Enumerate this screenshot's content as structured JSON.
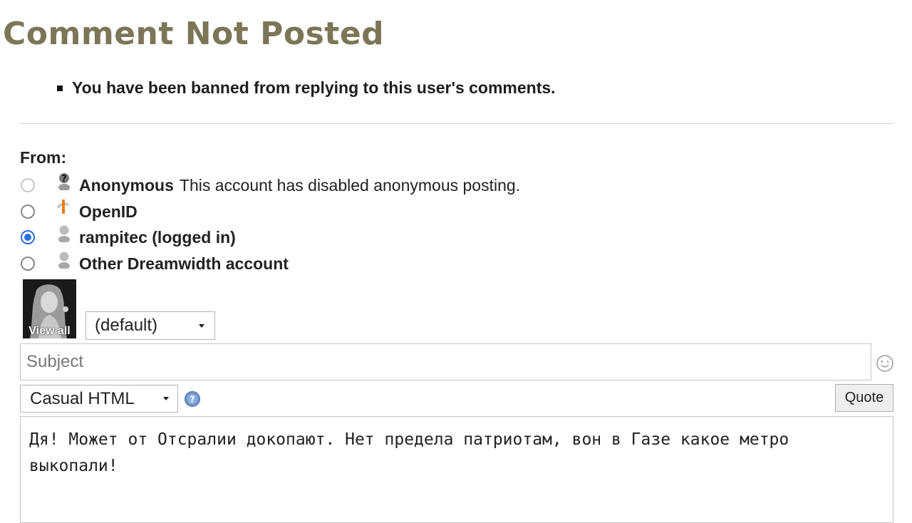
{
  "page": {
    "title": "Comment Not Posted"
  },
  "errors": [
    "You have been banned from replying to this user's comments."
  ],
  "form": {
    "from_label": "From:",
    "accounts": [
      {
        "name": "Anonymous",
        "note": "This account has disabled anonymous posting.",
        "icon": "anonymous-user-icon",
        "selected": false,
        "disabled": true
      },
      {
        "name": "OpenID",
        "note": "",
        "icon": "openid-icon",
        "selected": false,
        "disabled": false
      },
      {
        "name": "rampitec (logged in)",
        "note": "",
        "icon": "user-icon",
        "selected": true,
        "disabled": false
      },
      {
        "name": "Other Dreamwidth account",
        "note": "",
        "icon": "user-icon",
        "selected": false,
        "disabled": false
      }
    ],
    "userpic": {
      "link_label": "View all",
      "select_value": "(default)"
    },
    "subject": {
      "placeholder": "Subject",
      "value": ""
    },
    "format": {
      "select_value": "Casual HTML",
      "help_icon": "question-mark-icon"
    },
    "quote_button": "Quote",
    "body": "Дя! Может от Отсралии докопают. Нет предела патриотам, вон в Газе какое метро выкопали!",
    "colors": {
      "title": "#7a7656",
      "radio_checked": "#2b6ee0",
      "help_icon": "#6f93c9"
    }
  }
}
